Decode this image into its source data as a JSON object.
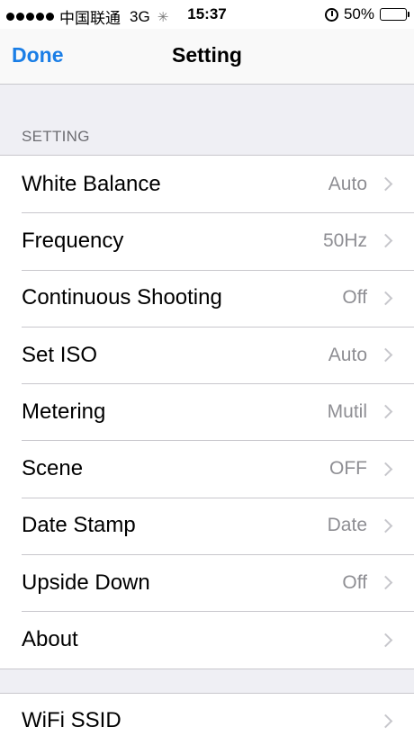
{
  "status_bar": {
    "carrier": "中国联通",
    "network": "3G",
    "time": "15:37",
    "battery": "50%"
  },
  "nav": {
    "done_label": "Done",
    "title": "Setting"
  },
  "section": {
    "header": "SETTING"
  },
  "settings": [
    {
      "label": "White Balance",
      "value": "Auto"
    },
    {
      "label": "Frequency",
      "value": "50Hz"
    },
    {
      "label": "Continuous Shooting",
      "value": "Off"
    },
    {
      "label": "Set ISO",
      "value": "Auto"
    },
    {
      "label": "Metering",
      "value": "Mutil"
    },
    {
      "label": "Scene",
      "value": "OFF"
    },
    {
      "label": "Date Stamp",
      "value": "Date"
    },
    {
      "label": "Upside Down",
      "value": "Off"
    },
    {
      "label": "About",
      "value": ""
    }
  ],
  "wifi": {
    "label": "WiFi SSID"
  },
  "colors": {
    "accent": "#1a7ee6",
    "background": "#efeff4",
    "secondary_text": "#8e8e93"
  }
}
